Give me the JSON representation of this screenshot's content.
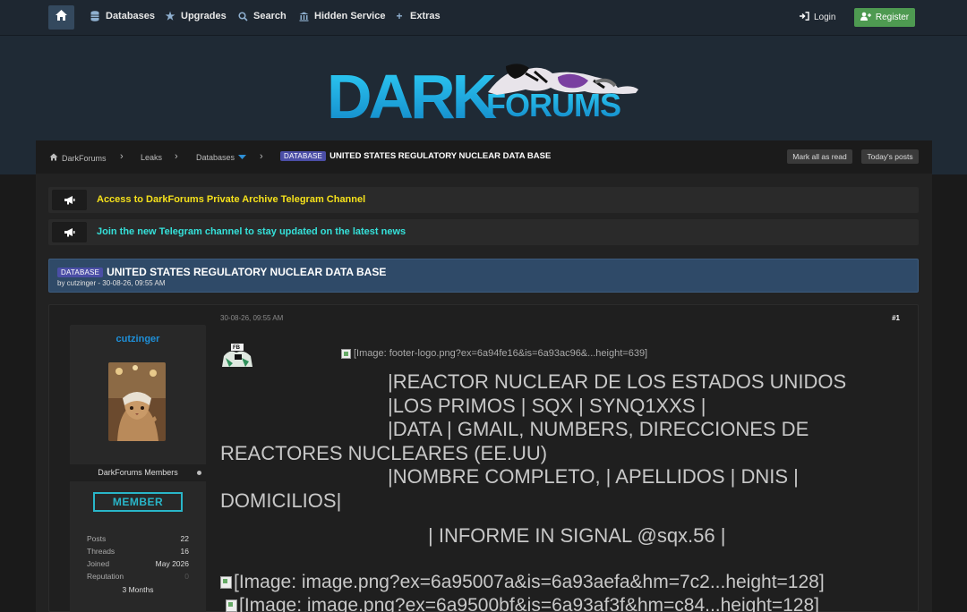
{
  "nav": {
    "items": [
      "Databases",
      "Upgrades",
      "Search",
      "Hidden Service",
      "Extras"
    ],
    "login": "Login",
    "register": "Register"
  },
  "logo": {
    "text_dark": "DARK",
    "text_forums": "FORUMS"
  },
  "breadcrumb": {
    "home": "DarkForums",
    "leaks": "Leaks",
    "databases": "Databases",
    "tag": "DATABASE",
    "current": "UNITED STATES REGULATORY NUCLEAR DATA BASE",
    "mark_read": "Mark all as read",
    "todays_posts": "Today's posts"
  },
  "announcements": [
    {
      "text": "Access to DarkForums Private Archive Telegram Channel",
      "color": "#f5e11b"
    },
    {
      "text": "Join the new Telegram channel to stay updated on the latest news",
      "color": "#35e0d9"
    }
  ],
  "thread": {
    "tag": "DATABASE",
    "title": "UNITED STATES REGULATORY NUCLEAR DATA BASE",
    "byline": "by cutzinger - 30-08-26, 09:55 AM"
  },
  "post": {
    "date": "30-08-26, 09:55 AM",
    "number": "#1",
    "user": {
      "name": "cutzinger",
      "group": "DarkForums Members",
      "badge": "MEMBER",
      "stats": [
        {
          "label": "Posts",
          "value": "22"
        },
        {
          "label": "Threads",
          "value": "16"
        },
        {
          "label": "Joined",
          "value": "May 2026"
        },
        {
          "label": "Reputation",
          "value": "0"
        }
      ],
      "extra": "3 Months"
    },
    "footer_img": "[Image: footer-logo.png?ex=6a94fe16&is=6a93ac96&...height=639]",
    "lines": [
      "|REACTOR NUCLEAR DE LOS ESTADOS UNIDOS",
      "|LOS PRIMOS | SQX | SYNQ1XXS |",
      "|DATA | GMAIL, NUMBERS, DIRECCIONES DE",
      "REACTORES NUCLEARES (EE.UU)",
      "|NOMBRE COMPLETO, | APELLIDOS | DNIS |",
      "DOMICILIOS|",
      "| INFORME IN SIGNAL @sqx.56  |"
    ],
    "img1": "[Image: image.png?ex=6a95007a&is=6a93aefa&hm=7c2...height=128]",
    "img2": "[Image: image.png?ex=6a9500bf&is=6a93af3f&hm=c84...height=128]"
  }
}
